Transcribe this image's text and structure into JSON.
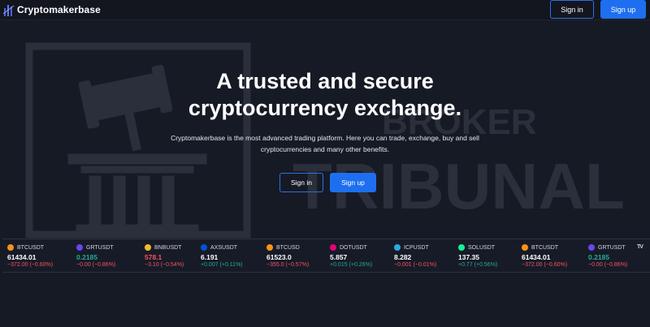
{
  "brand": {
    "name": "Cryptomakerbase",
    "logo_icon": "bar-chart-logo-icon"
  },
  "nav": {
    "signin_label": "Sign in",
    "signup_label": "Sign up"
  },
  "hero": {
    "title_line1": "A trusted and secure",
    "title_line2": "cryptocurrency exchange.",
    "description_line1": "Cryptomakerbase is the most advanced trading platform. Here you can trade, exchange, buy and sell",
    "description_line2": "cryptocurrencies and many other benefits.",
    "signin_label": "Sign in",
    "signup_label": "Sign up"
  },
  "watermark": {
    "line1": "BROKER",
    "line2": "TRIBUNAL",
    "icon": "gavel-column-watermark-icon"
  },
  "ticker": {
    "items": [
      {
        "symbol": "BTCUSDT",
        "price": "61434.01",
        "change": "−372.00 (−0.60%)",
        "direction": "down",
        "icon_color": "#f7931a",
        "price_color": "#ffffff"
      },
      {
        "symbol": "GRTUSDT",
        "price": "0.2185",
        "change": "−0.00 (−0.86%)",
        "direction": "down",
        "icon_color": "#6747ed",
        "price_color": "#22ab94"
      },
      {
        "symbol": "BNBUSDT",
        "price": "578.1",
        "change": "−3.10 (−0.54%)",
        "direction": "down",
        "icon_color": "#f3ba2f",
        "price_color": "#f7525f"
      },
      {
        "symbol": "AXSUSDT",
        "price": "6.191",
        "change": "+0.007 (+0.11%)",
        "direction": "up",
        "icon_color": "#0055d5",
        "price_color": "#ffffff"
      },
      {
        "symbol": "BTCUSD",
        "price": "61523.0",
        "change": "−355.0 (−0.57%)",
        "direction": "down",
        "icon_color": "#f7931a",
        "price_color": "#ffffff"
      },
      {
        "symbol": "DOTUSDT",
        "price": "5.857",
        "change": "+0.015 (+0.26%)",
        "direction": "up",
        "icon_color": "#e6007a",
        "price_color": "#ffffff"
      },
      {
        "symbol": "ICPUSDT",
        "price": "8.282",
        "change": "−0.001 (−0.01%)",
        "direction": "down",
        "icon_color": "#29abe2",
        "price_color": "#ffffff"
      },
      {
        "symbol": "SOLUSDT",
        "price": "137.35",
        "change": "+0.77 (+0.56%)",
        "direction": "up",
        "icon_color": "#14f195",
        "price_color": "#ffffff"
      },
      {
        "symbol": "BTCUSDT",
        "price": "61434.01",
        "change": "−372.00 (−0.60%)",
        "direction": "down",
        "icon_color": "#f7931a",
        "price_color": "#ffffff"
      },
      {
        "symbol": "GRTUSDT",
        "price": "0.2185",
        "change": "−0.00 (−0.86%)",
        "direction": "down",
        "icon_color": "#6747ed",
        "price_color": "#22ab94"
      }
    ],
    "widget_logo": "TV"
  },
  "colors": {
    "background": "#161a25",
    "accent": "#1e6ff0",
    "negative": "#f7525f",
    "positive": "#22ab94"
  }
}
